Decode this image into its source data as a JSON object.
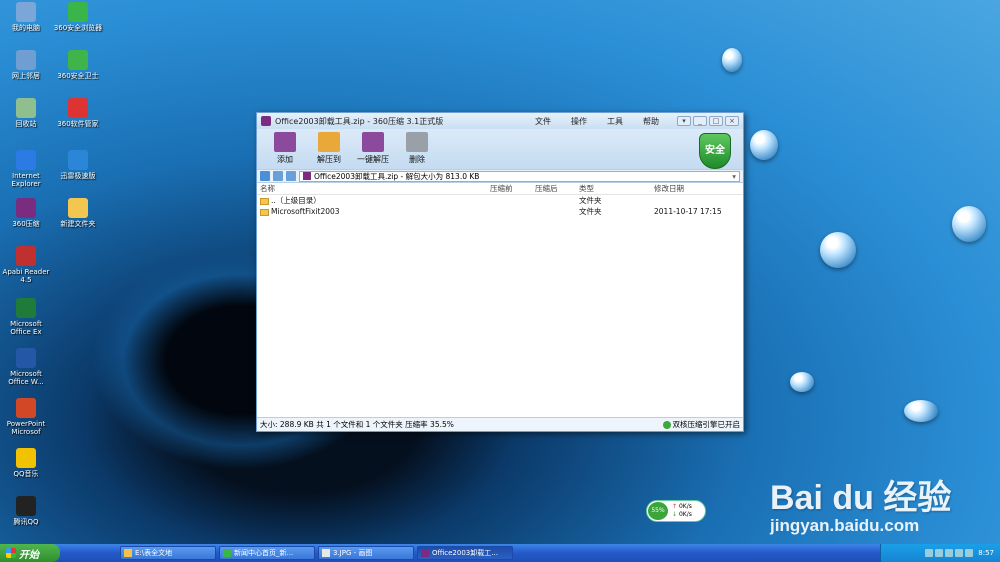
{
  "desktop": {
    "icons": [
      {
        "label": "我的电脑",
        "color": "#7aa6d8"
      },
      {
        "label": "360安全浏览器",
        "color": "#39b54a"
      },
      {
        "label": "网上邻居",
        "color": "#6f9fd2"
      },
      {
        "label": "360安全卫士",
        "color": "#3fb44a"
      },
      {
        "label": "回收站",
        "color": "#8fbf8f"
      },
      {
        "label": "360软件管家",
        "color": "#d33"
      },
      {
        "label": "Internet Explorer",
        "color": "#2c7be5"
      },
      {
        "label": "迅雷极速版",
        "color": "#2b86d8"
      },
      {
        "label": "360压缩",
        "color": "#7a2c80"
      },
      {
        "label": "新建文件夹",
        "color": "#f3c650"
      },
      {
        "label": "Apabi Reader 4.5",
        "color": "#c03030"
      },
      {
        "label": "Microsoft Office Ex",
        "color": "#1e7b3a"
      },
      {
        "label": "Microsoft Office W...",
        "color": "#2457a6"
      },
      {
        "label": "PowerPoint Microsof",
        "color": "#d24726"
      },
      {
        "label": "QQ音乐",
        "color": "#f2c200"
      },
      {
        "label": "腾讯QQ",
        "color": "#222"
      }
    ]
  },
  "window": {
    "title": "Office2003卸载工具.zip - 360压缩 3.1正式版",
    "menu": [
      "文件",
      "操作",
      "工具",
      "帮助"
    ],
    "controls": [
      "▾",
      "_",
      "□",
      "×"
    ],
    "toolbar": [
      {
        "label": "添加",
        "color": "#8b4a9c"
      },
      {
        "label": "解压到",
        "color": "#e8a93a"
      },
      {
        "label": "一键解压",
        "color": "#8b4a9c"
      },
      {
        "label": "删除",
        "color": "#9aa0a8"
      }
    ],
    "shield_text": "安全",
    "address": "Office2003卸载工具.zip - 解包大小为 813.0 KB",
    "columns": [
      "名称",
      "压缩前",
      "压缩后",
      "类型",
      "修改日期"
    ],
    "rows": [
      {
        "name": "..（上级目录）",
        "before": "",
        "after": "",
        "type": "文件夹",
        "date": ""
      },
      {
        "name": "MicrosoftFixit2003",
        "before": "",
        "after": "",
        "type": "文件夹",
        "date": "2011-10-17 17:15"
      }
    ],
    "status": "大小: 288.9 KB 共 1 个文件和 1 个文件夹 压缩率 35.5%",
    "engine_status": "双核压缩引擎已开启"
  },
  "speed_widget": {
    "percent": "55%",
    "up": "0K/s",
    "down": "0K/s"
  },
  "watermark": {
    "brand": "Bai du 经验",
    "url": "jingyan.baidu.com"
  },
  "taskbar": {
    "start": "开始",
    "tasks": [
      {
        "label": "E:\\表全文地",
        "active": false
      },
      {
        "label": "新闻中心首页_新...",
        "active": false
      },
      {
        "label": "3.JPG - 画图",
        "active": false
      },
      {
        "label": "Office2003卸载工...",
        "active": true
      }
    ],
    "clock": "8:57"
  }
}
